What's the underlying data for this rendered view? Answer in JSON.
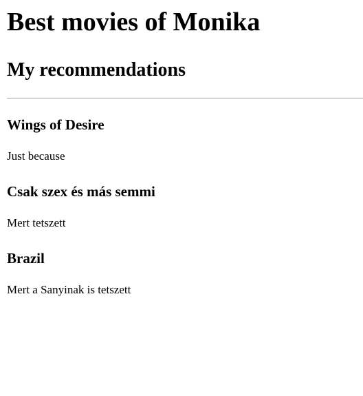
{
  "page": {
    "title": "Best movies of Monika",
    "subtitle": "My recommendations"
  },
  "movies": [
    {
      "title": "Wings of Desire",
      "reason": "Just because"
    },
    {
      "title": "Csak szex és más semmi",
      "reason": "Mert tetszett"
    },
    {
      "title": "Brazil",
      "reason": "Mert a Sanyinak is tetszett"
    }
  ]
}
